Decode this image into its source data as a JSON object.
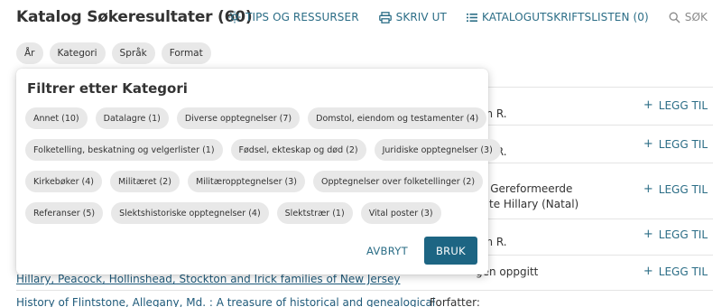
{
  "header": {
    "title": "Katalog Søkeresultater (60)",
    "actions": [
      {
        "label": "TIPS OG RESSURSER",
        "icon": "lightbulb-icon"
      },
      {
        "label": "SKRIV UT",
        "icon": "printer-icon"
      },
      {
        "label": "KATALOGUTSKRIFTSLISTEN (0)",
        "icon": "list-icon"
      },
      {
        "label": "SØK",
        "icon": "search-icon"
      }
    ]
  },
  "facets": [
    "År",
    "Kategori",
    "Språk",
    "Format"
  ],
  "results": {
    "fragments": [
      "am R.",
      "am R.",
      "e Gereformeerde",
      "ente Hillary (Natal)",
      "am R.",
      "gen oppgitt"
    ],
    "add_label": "LEGG TIL",
    "link1": "Hillary, Peacock, Hollinshead, Stockton and Irick families of New Jersey",
    "link2": "History of Flintstone, Allegany, Md. : A treasure of historical and genealogical",
    "author_label": "Forfatter:"
  },
  "modal": {
    "title": "Filtrer etter Kategori",
    "rows": [
      [
        "Annet (10)",
        "Datalagre (1)",
        "Diverse opptegnelser (7)",
        "Domstol, eiendom og testamenter (4)"
      ],
      [
        "Folketelling, beskatning og velgerlister (1)",
        "Fødsel, ekteskap og død (2)",
        "Juridiske opptegnelser (3)"
      ],
      [
        "Kirkebøker (4)",
        "Militæret (2)",
        "Militæropptegnelser (3)",
        "Opptegnelser over folketellinger (2)"
      ],
      [
        "Referanser (5)",
        "Slektshistoriske opptegnelser (4)",
        "Slektstrær (1)",
        "Vital poster (3)"
      ]
    ],
    "cancel_label": "AVBRYT",
    "apply_label": "BRUK"
  },
  "colors": {
    "accent": "#2b6d86",
    "primary_button": "#1d6583",
    "chip_bg": "#e8e8e8",
    "link": "#1f5a7a"
  }
}
